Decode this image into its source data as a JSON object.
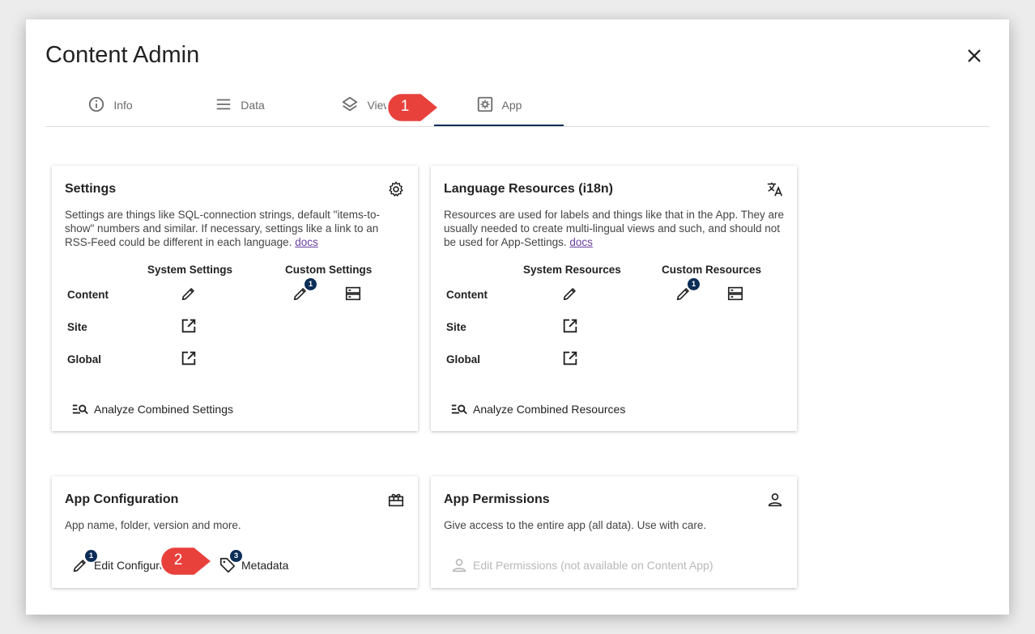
{
  "dialog": {
    "title": "Content Admin"
  },
  "tabs": [
    {
      "label": "Info",
      "icon": "info-icon"
    },
    {
      "label": "Data",
      "icon": "list-icon"
    },
    {
      "label": "Views",
      "icon": "layers-icon"
    },
    {
      "label": "App",
      "icon": "app-settings-icon"
    }
  ],
  "callouts": {
    "one": "1",
    "two": "2"
  },
  "settings": {
    "title": "Settings",
    "description": "Settings are things like SQL-connection strings, default \"items-to-show\" numbers and similar. If necessary, settings like a link to an RSS-Feed could be different in each language.",
    "docs": "docs",
    "col_system": "System Settings",
    "col_custom": "Custom Settings",
    "rows": [
      "Content",
      "Site",
      "Global"
    ],
    "badge": "1",
    "analyze": "Analyze Combined Settings"
  },
  "resources": {
    "title": "Language Resources (i18n)",
    "description": "Resources are used for labels and things like that in the App. They are usually needed to create multi-lingual views and such, and should not be used for App-Settings.",
    "docs": "docs",
    "col_system": "System Resources",
    "col_custom": "Custom Resources",
    "rows": [
      "Content",
      "Site",
      "Global"
    ],
    "badge": "1",
    "analyze": "Analyze Combined Resources"
  },
  "app_config": {
    "title": "App Configuration",
    "description": "App name, folder, version and more.",
    "edit_label": "Edit Configuration",
    "edit_badge": "1",
    "metadata_label": "Metadata",
    "metadata_badge": "3"
  },
  "app_permissions": {
    "title": "App Permissions",
    "description": "Give access to the entire app (all data). Use with care.",
    "edit_label": "Edit Permissions (not available on Content App)"
  },
  "colors": {
    "accent": "#0b2d57",
    "callout": "#e8413c",
    "link": "#6a3fa0"
  }
}
